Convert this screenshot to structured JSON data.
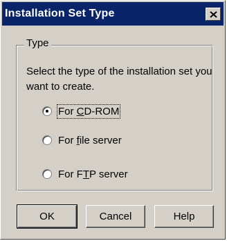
{
  "window": {
    "title": "Installation Set Type"
  },
  "group": {
    "legend": "Type",
    "instruction": "Select the type of the installation set you want to create."
  },
  "options": [
    {
      "pre": "For ",
      "mnemonic": "C",
      "post": "D-ROM",
      "checked": true
    },
    {
      "pre": "For ",
      "mnemonic": "f",
      "post": "ile server",
      "checked": false
    },
    {
      "pre": "For F",
      "mnemonic": "T",
      "post": "P server",
      "checked": false
    }
  ],
  "buttons": {
    "ok": "OK",
    "cancel": "Cancel",
    "help": "Help"
  }
}
